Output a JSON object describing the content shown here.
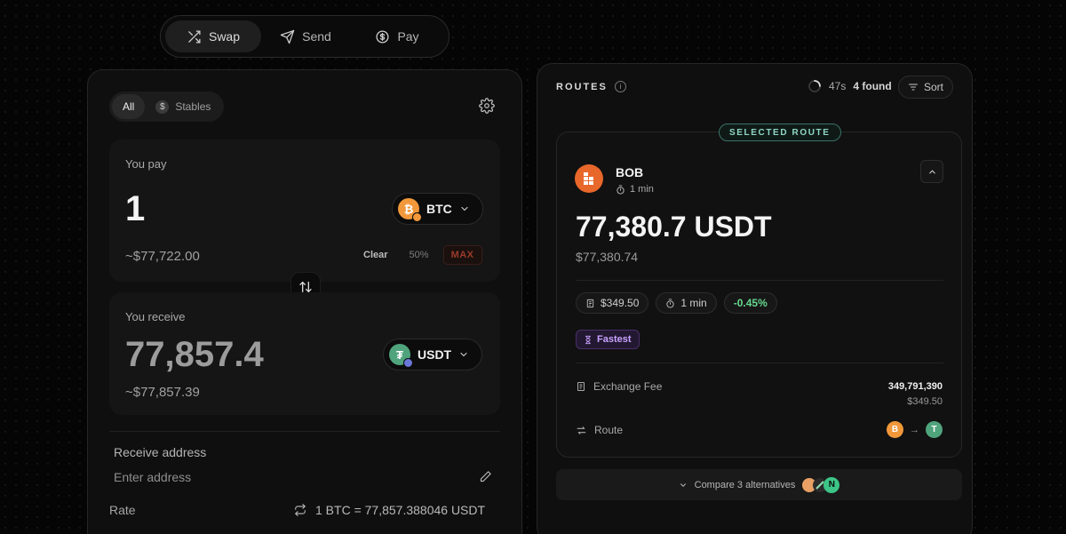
{
  "tabs": [
    {
      "label": "Swap",
      "icon": "shuffle-icon",
      "active": true
    },
    {
      "label": "Send",
      "icon": "paper-plane-icon",
      "active": false
    },
    {
      "label": "Pay",
      "icon": "dollar-coin-icon",
      "active": false
    }
  ],
  "swap": {
    "filters": {
      "all": "All",
      "stables": "Stables",
      "stables_icon": "$"
    },
    "pay": {
      "label": "You pay",
      "amount": "1",
      "usd": "~$77,722.00",
      "token": "BTC",
      "clear": "Clear",
      "half": "50%",
      "max": "MAX"
    },
    "receive": {
      "label": "You receive",
      "amount": "77,857.4",
      "usd": "~$77,857.39",
      "token": "USDT"
    },
    "address": {
      "label": "Receive address",
      "placeholder": "Enter address"
    },
    "rate": {
      "label": "Rate",
      "value": "1 BTC = 77,857.388046 USDT"
    }
  },
  "routes": {
    "title": "ROUTES",
    "info": "i",
    "timer": "47s",
    "found": "4 found",
    "sort": "Sort",
    "selected": {
      "tag": "SELECTED ROUTE",
      "provider": "BOB",
      "eta": "1 min",
      "amount": "77,380.7 USDT",
      "usd": "$77,380.74",
      "chips": {
        "fee": "$349.50",
        "time": "1 min",
        "impact": "-0.45%"
      },
      "badge": "Fastest",
      "exchange_fee_label": "Exchange Fee",
      "exchange_fee_value": "349,791,390",
      "exchange_fee_usd": "$349.50",
      "route_label": "Route",
      "route_arrow": "→",
      "route_from_symbol": "B",
      "route_to_symbol": "T"
    },
    "compare": "Compare 3 alternatives",
    "compare_icon_letter": "N"
  },
  "colors": {
    "btc": "#f1983a",
    "usdt": "#50a47d",
    "bob": "#e8672a",
    "positive": "#66d88f",
    "fastest": "#c8a2ff",
    "max": "#9b3a2a"
  }
}
